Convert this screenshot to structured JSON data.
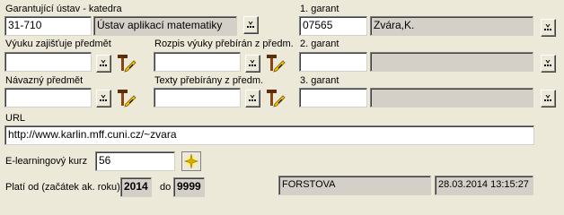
{
  "guarantor_dept": {
    "label": "Garantující ústav - katedra",
    "code": "31-710",
    "name": "Ústav aplikací matematiky"
  },
  "guarantor1": {
    "label": "1. garant",
    "id": "07565",
    "name": "Zvára,K."
  },
  "guarantor2": {
    "label": "2. garant",
    "id": "",
    "name": ""
  },
  "guarantor3": {
    "label": "3. garant",
    "id": "",
    "name": ""
  },
  "teaching_provided": {
    "label": "Výuku zajišťuje předmět",
    "value": ""
  },
  "schedule_taken": {
    "label": "Rozpis výuky přebírán z předm.",
    "value": ""
  },
  "follow_up": {
    "label": "Návazný předmět",
    "value": ""
  },
  "texts_taken": {
    "label": "Texty přebírány z předm.",
    "value": ""
  },
  "url": {
    "label": "URL",
    "value": "http://www.karlin.mff.cuni.cz/~zvara"
  },
  "elearning": {
    "label": "E-learningový kurz",
    "value": "56"
  },
  "valid": {
    "from_label": "Platí od (začátek ak. roku)",
    "from_value": "2014",
    "to_label": "do",
    "to_value": "9999"
  },
  "audit": {
    "user": "FORSTOVA",
    "timestamp": "28.03.2014 13:15:27"
  },
  "icons": {
    "lookup": "ellipsis-lookup-icon",
    "copy": "hammer-pencil-icon",
    "elearning": "sparkle-icon"
  }
}
